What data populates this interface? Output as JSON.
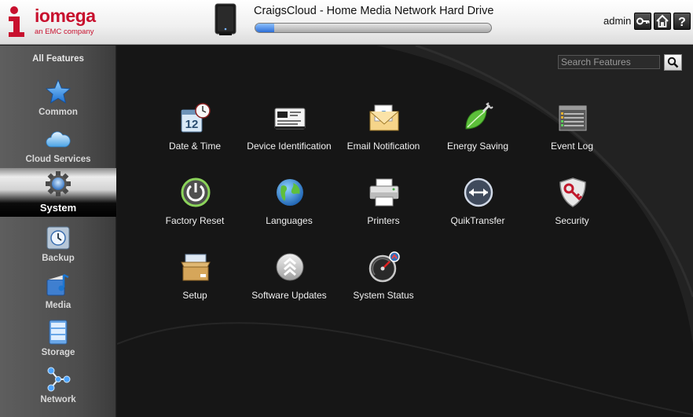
{
  "header": {
    "brand": "iomega",
    "brand_tag": "an EMC company",
    "device_title": "CraigsCloud - Home Media Network Hard Drive",
    "capacity_used_fraction": 0.08,
    "user": "admin",
    "icons": [
      "key-icon",
      "home-icon",
      "help-icon"
    ]
  },
  "sidebar": {
    "all_features": "All Features",
    "items": [
      {
        "label": "Common",
        "icon": "star-icon"
      },
      {
        "label": "Cloud Services",
        "icon": "cloud-icon"
      },
      {
        "label": "System",
        "icon": "gear-icon",
        "active": true
      },
      {
        "label": "Backup",
        "icon": "backup-icon"
      },
      {
        "label": "Media",
        "icon": "media-icon"
      },
      {
        "label": "Storage",
        "icon": "storage-icon"
      },
      {
        "label": "Network",
        "icon": "network-icon"
      }
    ]
  },
  "search": {
    "placeholder": "Search Features",
    "value": ""
  },
  "features": [
    {
      "label": "Date & Time",
      "icon": "calendar-clock-icon"
    },
    {
      "label": "Device Identification",
      "icon": "id-card-icon"
    },
    {
      "label": "Email Notification",
      "icon": "envelope-icon"
    },
    {
      "label": "Energy Saving",
      "icon": "leaf-plug-icon"
    },
    {
      "label": "Event Log",
      "icon": "log-icon"
    },
    {
      "label": "Factory Reset",
      "icon": "power-reset-icon"
    },
    {
      "label": "Languages",
      "icon": "globe-icon"
    },
    {
      "label": "Printers",
      "icon": "printer-icon"
    },
    {
      "label": "QuikTransfer",
      "icon": "transfer-arrows-icon"
    },
    {
      "label": "Security",
      "icon": "shield-key-icon"
    },
    {
      "label": "Setup",
      "icon": "box-icon"
    },
    {
      "label": "Software Updates",
      "icon": "update-chevrons-icon"
    },
    {
      "label": "System Status",
      "icon": "gauge-icon"
    }
  ],
  "colors": {
    "brand_red": "#c8102e",
    "progress_blue": "#2e6fd6"
  }
}
